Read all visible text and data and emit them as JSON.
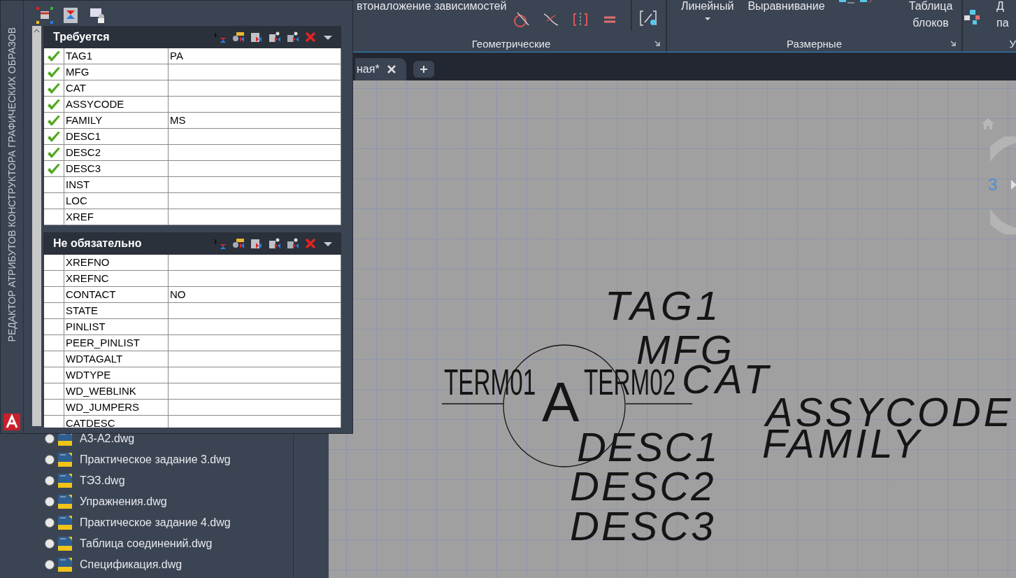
{
  "palette": {
    "title": "РЕДАКТОР АТРИБУТОВ КОНСТРУКТОРА ГРАФИЧЕСКИХ ОБРАЗОВ",
    "sections": [
      {
        "title": "Требуется",
        "rows": [
          {
            "name": "TAG1",
            "value": "PA",
            "checked": true
          },
          {
            "name": "MFG",
            "checked": true
          },
          {
            "name": "CAT",
            "checked": true
          },
          {
            "name": "ASSYCODE",
            "checked": true
          },
          {
            "name": "FAMILY",
            "value": "MS",
            "checked": true
          },
          {
            "name": "DESC1",
            "checked": true
          },
          {
            "name": "DESC2",
            "checked": true
          },
          {
            "name": "DESC3",
            "checked": true
          },
          {
            "name": "INST",
            "checked": false
          },
          {
            "name": "LOC",
            "checked": false
          },
          {
            "name": "XREF",
            "checked": false
          }
        ]
      },
      {
        "title": "Не обязательно",
        "rows": [
          {
            "name": "XREFNO",
            "checked": false
          },
          {
            "name": "XREFNC",
            "checked": false
          },
          {
            "name": "CONTACT",
            "value": "NO",
            "checked": false
          },
          {
            "name": "STATE",
            "checked": false
          },
          {
            "name": "PINLIST",
            "checked": false
          },
          {
            "name": "PEER_PINLIST",
            "checked": false
          },
          {
            "name": "WDTAGALT",
            "checked": false
          },
          {
            "name": "WDTYPE",
            "checked": false
          },
          {
            "name": "WD_WEBLINK",
            "checked": false
          },
          {
            "name": "WD_JUMPERS",
            "checked": false
          },
          {
            "name": "CATDESC",
            "checked": false
          }
        ]
      }
    ]
  },
  "ribbon": {
    "constraints_label": "втоналожение зависимостей",
    "linear": "Линейный",
    "align": "Выравнивание",
    "table_line1": "Таблица",
    "table_line2": "блоков",
    "cut_line1": "Д",
    "cut_line2": "па",
    "panels": [
      "Геометрические",
      "Размерные",
      "У"
    ]
  },
  "tabs": [
    {
      "label": "ная*",
      "selected": true
    }
  ],
  "file_tree": [
    {
      "name": "А3-А2.dwg",
      "selected": false
    },
    {
      "name": "Практическое задание 3.dwg",
      "selected": false
    },
    {
      "name": "ТЭЗ.dwg",
      "selected": false
    },
    {
      "name": "Упражнения.dwg",
      "selected": false
    },
    {
      "name": "Практическое задание 4.dwg",
      "selected": false
    },
    {
      "name": "Таблица соединений.dwg",
      "selected": false
    },
    {
      "name": "Спецификация.dwg",
      "selected": false
    }
  ],
  "canvas": {
    "texts": [
      {
        "text": "TAG1",
        "kind": "attribute"
      },
      {
        "text": "MFG",
        "kind": "attribute"
      },
      {
        "text": "TERM01",
        "kind": "terminal"
      },
      {
        "text": "A",
        "kind": "symbol"
      },
      {
        "text": "TERM02",
        "kind": "terminal"
      },
      {
        "text": "CAT",
        "kind": "attribute"
      },
      {
        "text": "ASSYCODE",
        "kind": "attribute"
      },
      {
        "text": "DESC1",
        "kind": "attribute"
      },
      {
        "text": "FAMILY",
        "kind": "attribute"
      },
      {
        "text": "DESC2",
        "kind": "attribute"
      },
      {
        "text": "DESC3",
        "kind": "attribute"
      }
    ],
    "viewcube_label": "3"
  }
}
